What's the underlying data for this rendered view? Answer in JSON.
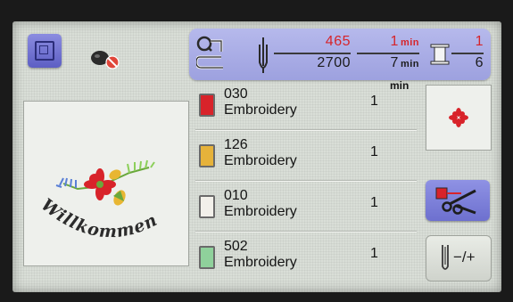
{
  "status": {
    "stitch_current": "465",
    "stitch_total": "2700",
    "time_current": "1",
    "time_total": "7",
    "time_unit": "min",
    "color_current": "1",
    "color_total": "6"
  },
  "list": {
    "min_header": "min",
    "rows": [
      {
        "code": "030",
        "thread": "Embroidery",
        "minutes": "1",
        "color": "#d8232a"
      },
      {
        "code": "126",
        "thread": "Embroidery",
        "minutes": "1",
        "color": "#e6b23a"
      },
      {
        "code": "010",
        "thread": "Embroidery",
        "minutes": "1",
        "color": "#f2f0ea"
      },
      {
        "code": "502",
        "thread": "Embroidery",
        "minutes": "1",
        "color": "#8fd19b"
      }
    ]
  },
  "preview": {
    "text": "Willkommen"
  },
  "buttons": {
    "adjust_label": "−/+"
  },
  "colors": {
    "accent": "#7c80d8",
    "screen_bg": "#d9ded7",
    "current_value": "#d6242a"
  }
}
